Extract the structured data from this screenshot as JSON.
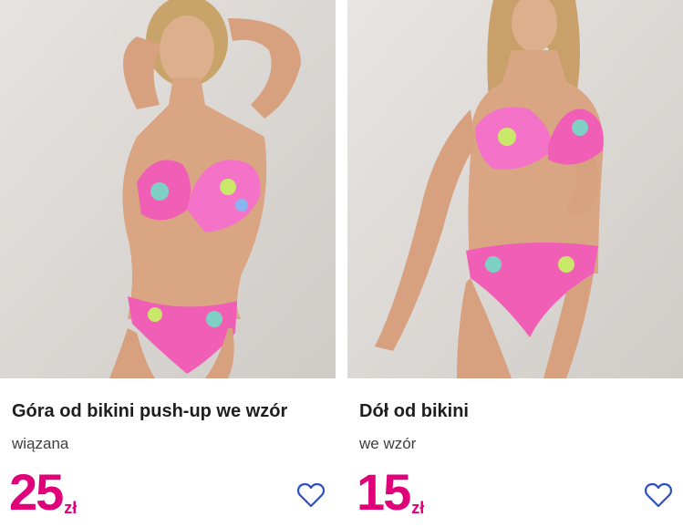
{
  "products": [
    {
      "title": "Góra od bikini push-up we wzór",
      "subtitle": "wiązana",
      "price": "25",
      "currency": "zł",
      "favorite_icon": "heart-outline-icon",
      "image_alt": "model in pink tropical print bikini"
    },
    {
      "title": "Dół od bikini",
      "subtitle": "we wzór",
      "price": "15",
      "currency": "zł",
      "favorite_icon": "heart-outline-icon",
      "image_alt": "model in pink tropical print bikini bottom"
    }
  ],
  "colors": {
    "price": "#e0007a",
    "heart": "#2d4fbf",
    "title": "#1e1e1e",
    "photo_bg": "#d9d6d3"
  }
}
